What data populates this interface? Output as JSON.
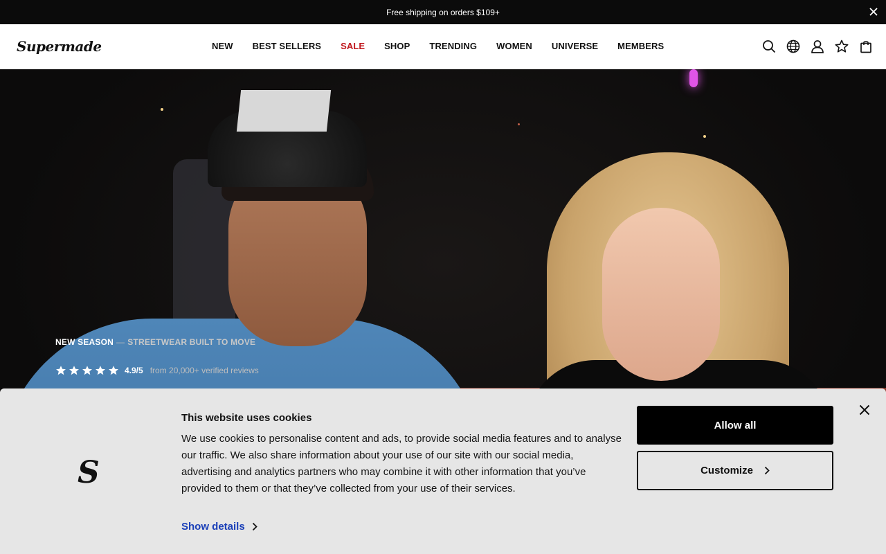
{
  "announcement": {
    "text": "Free shipping on orders $109+",
    "close_icon": "close-icon"
  },
  "header": {
    "logo": "Supermade",
    "nav": [
      {
        "label": "NEW"
      },
      {
        "label": "BEST SELLERS"
      },
      {
        "label": "SALE",
        "color": "#c0171d"
      },
      {
        "label": "SHOP"
      },
      {
        "label": "TRENDING"
      },
      {
        "label": "WOMEN"
      },
      {
        "label": "UNIVERSE"
      },
      {
        "label": "MEMBERS"
      }
    ],
    "icons": [
      "search-icon",
      "globe-icon",
      "account-icon",
      "wishlist-star-icon",
      "cart-bag-icon"
    ]
  },
  "hero": {
    "tag": "NEW SEASON",
    "separator": "—",
    "subtitle": "STREETWEAR BUILT TO MOVE",
    "rating": {
      "stars": 5,
      "value": "4.9/5",
      "text": "from 20,000+ verified reviews"
    }
  },
  "cookie": {
    "logo_letter": "S",
    "title": "This website uses cookies",
    "body": "We use cookies to personalise content and ads, to provide social media features and to analyse our traffic. We also share information about your use of our site with our social media, advertising and analytics partners who may combine it with other information that you’ve provided to them or that they’ve collected from your use of their services.",
    "show_details": "Show details",
    "allow_all": "Allow all",
    "customize": "Customize"
  },
  "colors": {
    "sale": "#c0171d",
    "link": "#1a3fb8",
    "banner_bg": "#e6e6e6"
  }
}
